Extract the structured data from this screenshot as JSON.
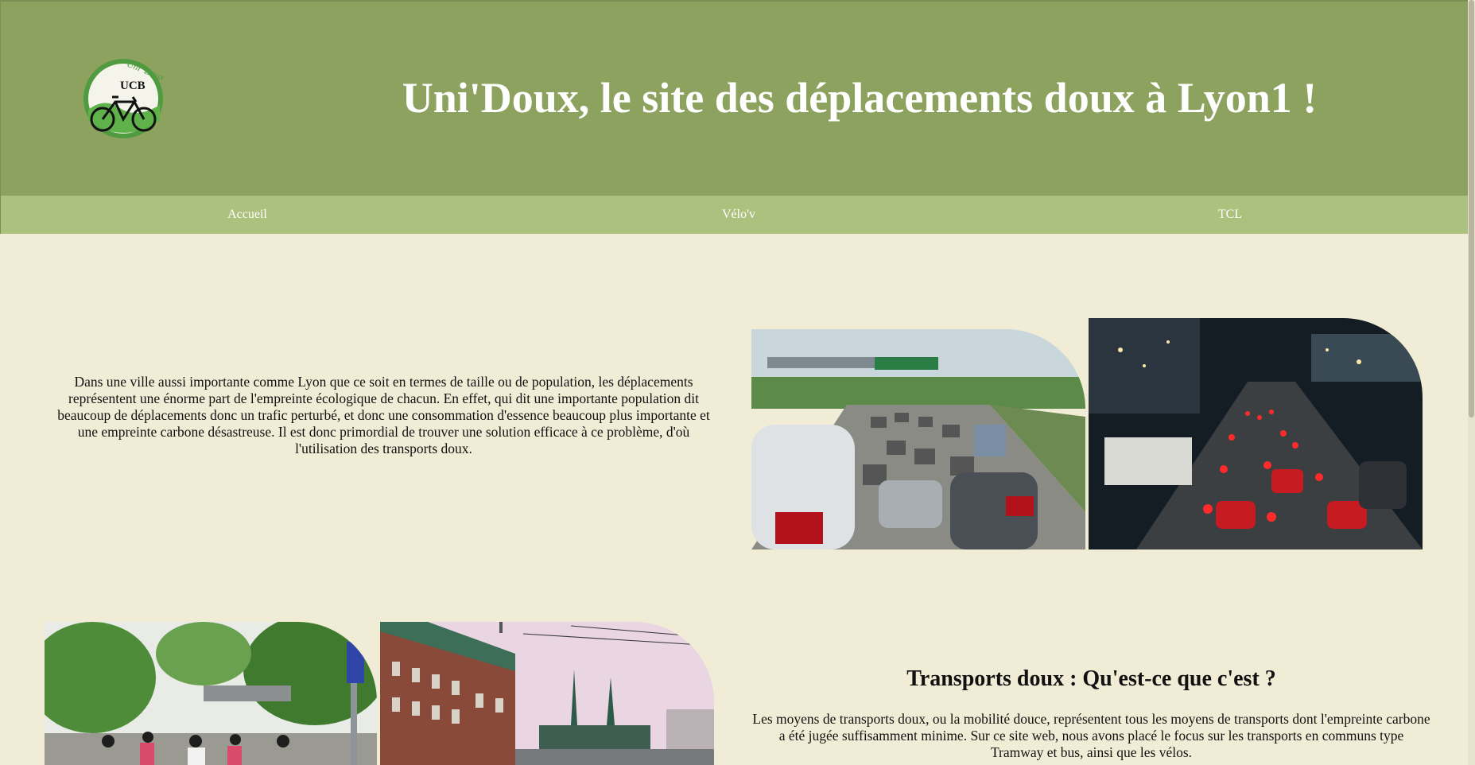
{
  "header": {
    "title": "Uni'Doux, le site des déplacements doux à Lyon1 !",
    "logo": {
      "arc_text": "Uni' Doux",
      "monogram": "UCB"
    }
  },
  "nav": {
    "items": [
      {
        "label": "Accueil"
      },
      {
        "label": "Vélo'v"
      },
      {
        "label": "TCL"
      }
    ]
  },
  "intro": {
    "text": "Dans une ville aussi importante comme Lyon que ce soit en termes de taille ou de population, les déplacements représentent une énorme part de l'empreinte écologique de chacun. En effet, qui dit une importante population dit beaucoup de déplacements donc un trafic perturbé, et donc une consommation d'essence beaucoup plus importante et une empreinte carbone désastreuse. Il est donc primordial de trouver une solution efficace à ce problème, d'où l'utilisation des transports doux."
  },
  "soft_transport": {
    "heading": "Transports doux : Qu'est-ce que c'est ?",
    "text": "Les moyens de transports doux, ou la mobilité douce, représentent tous les moyens de transports dont l'empreinte carbone a été jugée suffisamment minime. Sur ce site web, nous avons placé le focus sur les transports en communs type Tramway et bus, ainsi que les vélos."
  },
  "colors": {
    "header_bg": "#8da25f",
    "nav_bg": "#adc17e",
    "page_bg": "#f1ecd6",
    "title_text": "#ffffff"
  }
}
